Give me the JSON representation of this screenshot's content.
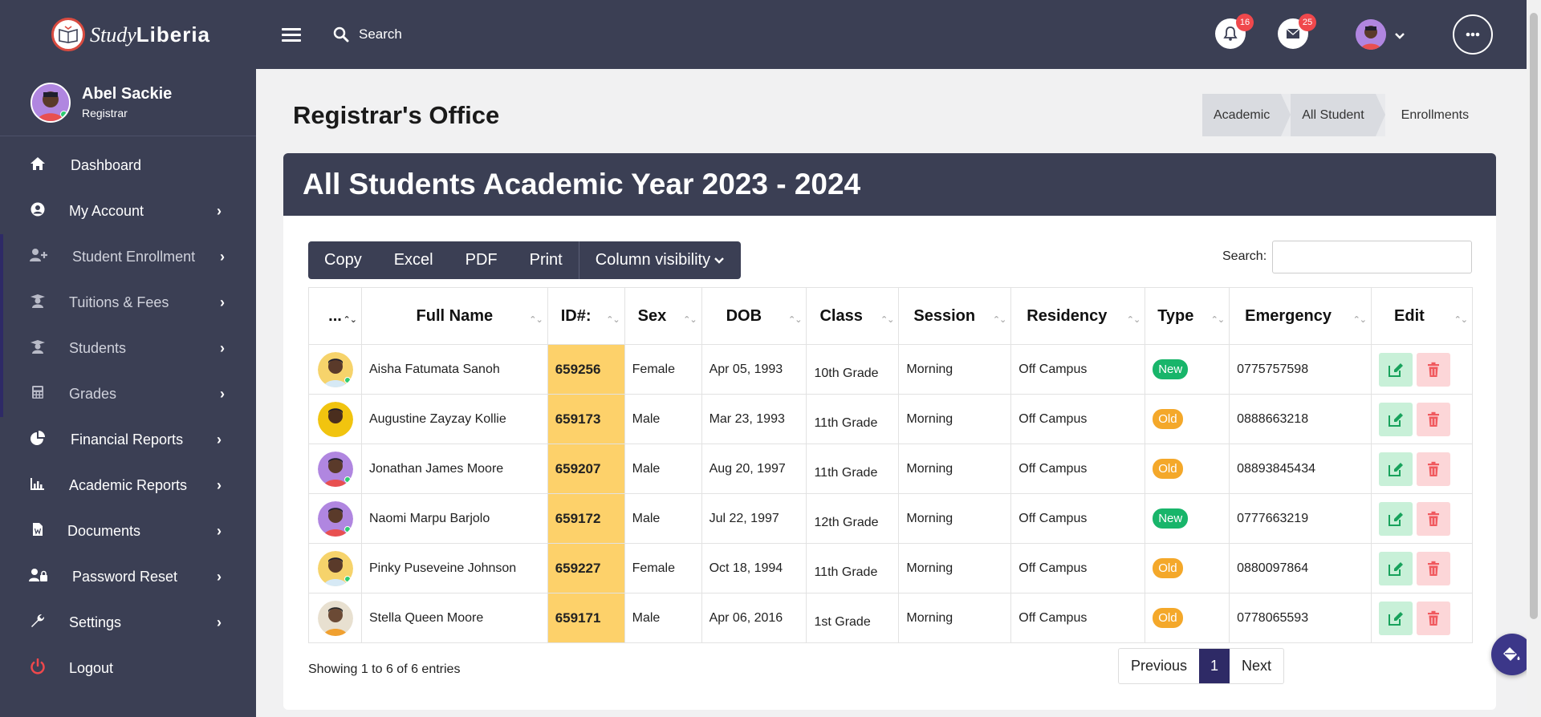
{
  "app": {
    "logo_text_italic": "Study",
    "logo_text_bold": "Liberia",
    "search_placeholder": "Search",
    "notifications_count": "16",
    "messages_count": "25"
  },
  "user": {
    "name": "Abel Sackie",
    "role": "Registrar"
  },
  "sidebar": {
    "items": [
      {
        "label": "Dashboard"
      },
      {
        "label": "My Account"
      },
      {
        "label": "Student Enrollment"
      },
      {
        "label": "Tuitions & Fees"
      },
      {
        "label": "Students"
      },
      {
        "label": "Grades"
      },
      {
        "label": "Financial Reports"
      },
      {
        "label": "Academic Reports"
      },
      {
        "label": "Documents"
      },
      {
        "label": "Password Reset"
      },
      {
        "label": "Settings"
      },
      {
        "label": "Logout"
      }
    ]
  },
  "page": {
    "title": "Registrar's Office",
    "breadcrumb": [
      "Academic",
      "All Student",
      "Enrollments"
    ],
    "card_title": "All Students Academic Year 2023 - 2024"
  },
  "toolbar": {
    "copy": "Copy",
    "excel": "Excel",
    "pdf": "PDF",
    "print": "Print",
    "colvis": "Column visibility",
    "search_label": "Search:"
  },
  "table": {
    "headers": [
      "...",
      "Full Name",
      "ID#:",
      "Sex",
      "DOB",
      "Class",
      "Session",
      "Residency",
      "Type",
      "Emergency",
      "Edit"
    ],
    "rows": [
      {
        "name": "Aisha Fatumata Sanoh",
        "id": "659256",
        "sex": "Female",
        "dob": "Apr 05, 1993",
        "class": "10th Grade",
        "session": "Morning",
        "residency": "Off Campus",
        "type": "New",
        "emergency": "0775757598"
      },
      {
        "name": "Augustine Zayzay Kollie",
        "id": "659173",
        "sex": "Male",
        "dob": "Mar 23, 1993",
        "class": "11th Grade",
        "session": "Morning",
        "residency": "Off Campus",
        "type": "Old",
        "emergency": "0888663218"
      },
      {
        "name": "Jonathan James Moore",
        "id": "659207",
        "sex": "Male",
        "dob": "Aug 20, 1997",
        "class": "11th Grade",
        "session": "Morning",
        "residency": "Off Campus",
        "type": "Old",
        "emergency": "08893845434"
      },
      {
        "name": "Naomi Marpu Barjolo",
        "id": "659172",
        "sex": "Male",
        "dob": "Jul 22, 1997",
        "class": "12th Grade",
        "session": "Morning",
        "residency": "Off Campus",
        "type": "New",
        "emergency": "0777663219"
      },
      {
        "name": "Pinky Puseveine Johnson",
        "id": "659227",
        "sex": "Female",
        "dob": "Oct 18, 1994",
        "class": "11th Grade",
        "session": "Morning",
        "residency": "Off Campus",
        "type": "Old",
        "emergency": "0880097864"
      },
      {
        "name": "Stella Queen Moore",
        "id": "659171",
        "sex": "Male",
        "dob": "Apr 06, 2016",
        "class": "1st Grade",
        "session": "Morning",
        "residency": "Off Campus",
        "type": "Old",
        "emergency": "0778065593"
      }
    ],
    "info": "Showing 1 to 6 of 6 entries"
  },
  "pager": {
    "previous": "Previous",
    "current": "1",
    "next": "Next"
  },
  "colors": {
    "sidebar_bg": "#3b3f54",
    "accent": "#2e2a66",
    "id_highlight": "#fdd16a",
    "badge_new": "#18b56a",
    "badge_old": "#f4a82a"
  }
}
